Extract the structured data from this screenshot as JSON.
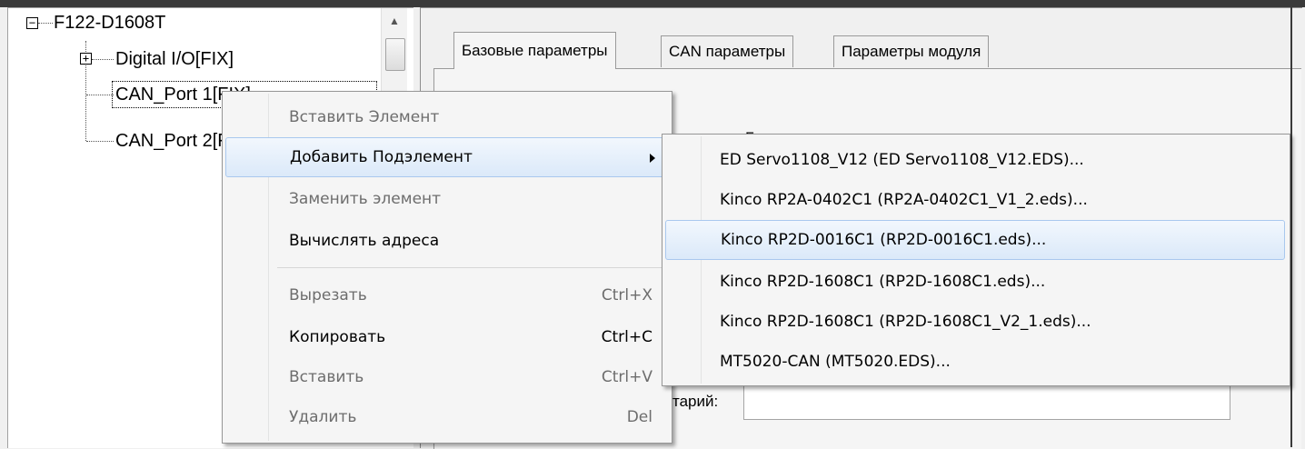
{
  "tree": {
    "root_label": "F122-D1608T",
    "root_toggle": "−",
    "children": [
      {
        "label": "Digital I/O[FIX]",
        "toggle": "+"
      },
      {
        "label": "CAN_Port 1[FIX]"
      },
      {
        "label": "CAN_Port 2[FIX]"
      }
    ]
  },
  "scrollbar": {
    "up_arrow": "▲"
  },
  "tabs": [
    {
      "label": "Базовые параметры",
      "active": true
    },
    {
      "label": "CAN параметры",
      "active": false
    },
    {
      "label": "Параметры модуля",
      "active": false
    }
  ],
  "form": {
    "partial_label_top": "Б",
    "comment_label": "тарий:",
    "comment_value": ""
  },
  "context_menu": {
    "items": [
      {
        "label": "Вставить Элемент",
        "enabled": false
      },
      {
        "label": "Добавить Подэлемент",
        "enabled": true,
        "has_submenu": true,
        "highlighted": true
      },
      {
        "label": "Заменить элемент",
        "enabled": false
      },
      {
        "label": "Вычислять адреса",
        "enabled": true
      },
      {
        "label": "Вырезать",
        "shortcut": "Ctrl+X",
        "enabled": false
      },
      {
        "label": "Копировать",
        "shortcut": "Ctrl+C",
        "enabled": true
      },
      {
        "label": "Вставить",
        "shortcut": "Ctrl+V",
        "enabled": false
      },
      {
        "label": "Удалить",
        "shortcut": "Del",
        "enabled": false
      }
    ]
  },
  "submenu": {
    "items": [
      {
        "label": "ED Servo1108_V12 (ED Servo1108_V12.EDS)..."
      },
      {
        "label": "Kinco RP2A-0402C1 (RP2A-0402C1_V1_2.eds)..."
      },
      {
        "label": "Kinco RP2D-0016C1 (RP2D-0016C1.eds)...",
        "highlighted": true
      },
      {
        "label": "Kinco RP2D-1608C1 (RP2D-1608C1.eds)..."
      },
      {
        "label": "Kinco RP2D-1608C1 (RP2D-1608C1_V2_1.eds)..."
      },
      {
        "label": "MT5020-CAN (MT5020.EDS)..."
      }
    ]
  },
  "colors": {
    "menu_bg": "#f5f5f5",
    "highlight_border": "#a9c8ee",
    "disabled_text": "#6d6d6d"
  }
}
